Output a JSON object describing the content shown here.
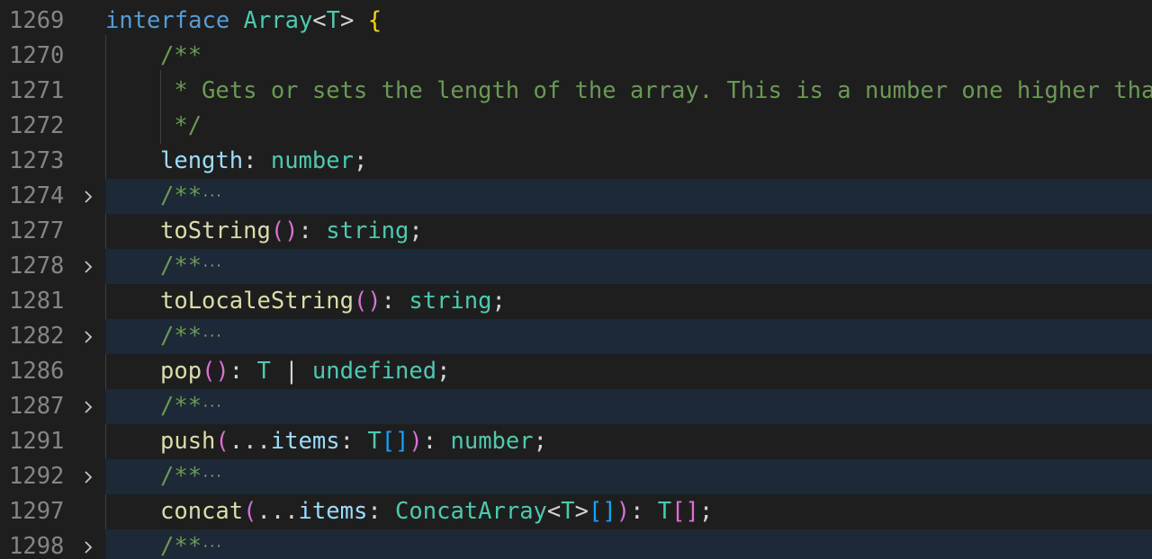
{
  "colors": {
    "keyword": "#569cd6",
    "type": "#4ec9b0",
    "bracket_gold": "#ffd700",
    "bracket_pink": "#da70d6",
    "bracket_blue": "#179fff",
    "comment": "#6a9955",
    "method": "#dcdcaa",
    "property": "#9cdcfe",
    "punct": "#d4d4d4",
    "line_number": "#858585",
    "fold_highlight": "#1d2936"
  },
  "lines": [
    {
      "num": "1269",
      "indent": 0,
      "fold": false,
      "tokens": [
        {
          "t": "interface",
          "c": "keyword"
        },
        {
          "t": " ",
          "c": "punct"
        },
        {
          "t": "Array",
          "c": "type"
        },
        {
          "t": "<",
          "c": "punct"
        },
        {
          "t": "T",
          "c": "type"
        },
        {
          "t": ">",
          "c": "punct"
        },
        {
          "t": " ",
          "c": "punct"
        },
        {
          "t": "{",
          "c": "bracket_gold"
        }
      ]
    },
    {
      "num": "1270",
      "indent": 1,
      "fold": false,
      "tokens": [
        {
          "t": "/**",
          "c": "comment"
        }
      ]
    },
    {
      "num": "1271",
      "indent": 1,
      "fold": false,
      "tokens": [
        {
          "t": " * Gets or sets the length of the array. This is a number one higher than the highest index in the array.",
          "c": "comment"
        }
      ]
    },
    {
      "num": "1272",
      "indent": 1,
      "fold": false,
      "tokens": [
        {
          "t": " */",
          "c": "comment"
        }
      ]
    },
    {
      "num": "1273",
      "indent": 1,
      "fold": false,
      "tokens": [
        {
          "t": "length",
          "c": "property"
        },
        {
          "t": ": ",
          "c": "punct"
        },
        {
          "t": "number",
          "c": "type"
        },
        {
          "t": ";",
          "c": "punct"
        }
      ]
    },
    {
      "num": "1274",
      "indent": 1,
      "fold": true,
      "tokens": [
        {
          "t": "/**",
          "c": "comment"
        },
        {
          "t": "···",
          "c": "ellipsis"
        }
      ]
    },
    {
      "num": "1277",
      "indent": 1,
      "fold": false,
      "tokens": [
        {
          "t": "toString",
          "c": "method"
        },
        {
          "t": "()",
          "c": "bracket_pink"
        },
        {
          "t": ": ",
          "c": "punct"
        },
        {
          "t": "string",
          "c": "type"
        },
        {
          "t": ";",
          "c": "punct"
        }
      ]
    },
    {
      "num": "1278",
      "indent": 1,
      "fold": true,
      "tokens": [
        {
          "t": "/**",
          "c": "comment"
        },
        {
          "t": "···",
          "c": "ellipsis"
        }
      ]
    },
    {
      "num": "1281",
      "indent": 1,
      "fold": false,
      "tokens": [
        {
          "t": "toLocaleString",
          "c": "method"
        },
        {
          "t": "()",
          "c": "bracket_pink"
        },
        {
          "t": ": ",
          "c": "punct"
        },
        {
          "t": "string",
          "c": "type"
        },
        {
          "t": ";",
          "c": "punct"
        }
      ]
    },
    {
      "num": "1282",
      "indent": 1,
      "fold": true,
      "tokens": [
        {
          "t": "/**",
          "c": "comment"
        },
        {
          "t": "···",
          "c": "ellipsis"
        }
      ]
    },
    {
      "num": "1286",
      "indent": 1,
      "fold": false,
      "tokens": [
        {
          "t": "pop",
          "c": "method"
        },
        {
          "t": "()",
          "c": "bracket_pink"
        },
        {
          "t": ": ",
          "c": "punct"
        },
        {
          "t": "T",
          "c": "type"
        },
        {
          "t": " | ",
          "c": "punct"
        },
        {
          "t": "undefined",
          "c": "type"
        },
        {
          "t": ";",
          "c": "punct"
        }
      ]
    },
    {
      "num": "1287",
      "indent": 1,
      "fold": true,
      "tokens": [
        {
          "t": "/**",
          "c": "comment"
        },
        {
          "t": "···",
          "c": "ellipsis"
        }
      ]
    },
    {
      "num": "1291",
      "indent": 1,
      "fold": false,
      "tokens": [
        {
          "t": "push",
          "c": "method"
        },
        {
          "t": "(",
          "c": "bracket_pink"
        },
        {
          "t": "...",
          "c": "punct"
        },
        {
          "t": "items",
          "c": "property"
        },
        {
          "t": ": ",
          "c": "punct"
        },
        {
          "t": "T",
          "c": "type"
        },
        {
          "t": "[]",
          "c": "bracket_blue"
        },
        {
          "t": ")",
          "c": "bracket_pink"
        },
        {
          "t": ": ",
          "c": "punct"
        },
        {
          "t": "number",
          "c": "type"
        },
        {
          "t": ";",
          "c": "punct"
        }
      ]
    },
    {
      "num": "1292",
      "indent": 1,
      "fold": true,
      "tokens": [
        {
          "t": "/**",
          "c": "comment"
        },
        {
          "t": "···",
          "c": "ellipsis"
        }
      ]
    },
    {
      "num": "1297",
      "indent": 1,
      "fold": false,
      "tokens": [
        {
          "t": "concat",
          "c": "method"
        },
        {
          "t": "(",
          "c": "bracket_pink"
        },
        {
          "t": "...",
          "c": "punct"
        },
        {
          "t": "items",
          "c": "property"
        },
        {
          "t": ": ",
          "c": "punct"
        },
        {
          "t": "ConcatArray",
          "c": "type"
        },
        {
          "t": "<",
          "c": "punct"
        },
        {
          "t": "T",
          "c": "type"
        },
        {
          "t": ">",
          "c": "punct"
        },
        {
          "t": "[]",
          "c": "bracket_blue"
        },
        {
          "t": ")",
          "c": "bracket_pink"
        },
        {
          "t": ": ",
          "c": "punct"
        },
        {
          "t": "T",
          "c": "type"
        },
        {
          "t": "[]",
          "c": "bracket_pink"
        },
        {
          "t": ";",
          "c": "punct"
        }
      ]
    },
    {
      "num": "1298",
      "indent": 1,
      "fold": true,
      "tokens": [
        {
          "t": "/**",
          "c": "comment"
        },
        {
          "t": "···",
          "c": "ellipsis"
        }
      ]
    }
  ]
}
